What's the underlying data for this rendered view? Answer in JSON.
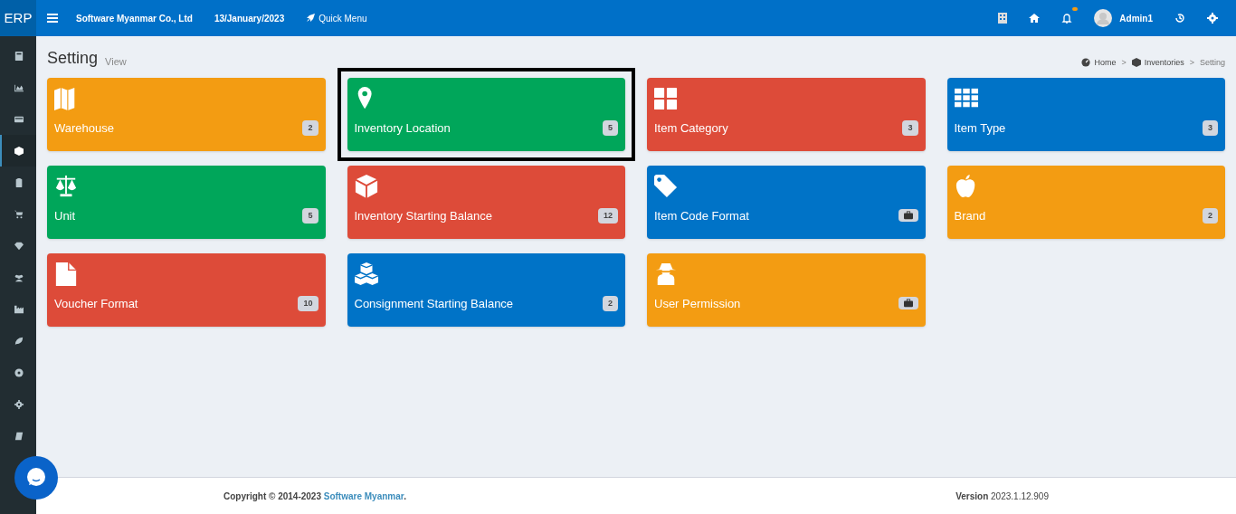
{
  "header": {
    "logo": "ERP",
    "company": "Software Myanmar Co., Ltd",
    "date": "13/January/2023",
    "quick_menu": "Quick Menu",
    "user": "Admin1",
    "notification_dot": true
  },
  "sidebar": {
    "items": [
      {
        "selected": false
      },
      {
        "selected": false
      },
      {
        "selected": false
      },
      {
        "selected": true
      },
      {
        "selected": false
      },
      {
        "selected": false
      },
      {
        "selected": false
      },
      {
        "selected": false
      },
      {
        "selected": false
      },
      {
        "selected": false
      },
      {
        "selected": false
      },
      {
        "selected": false
      },
      {
        "selected": false
      }
    ]
  },
  "page": {
    "title": "Setting",
    "subtitle": "View"
  },
  "breadcrumb": [
    {
      "kind": "link",
      "text": "Home"
    },
    {
      "kind": "separator",
      "text": ">"
    },
    {
      "kind": "link",
      "text": "Inventories"
    },
    {
      "kind": "separator",
      "text": ">"
    },
    {
      "kind": "current",
      "text": "Setting"
    }
  ],
  "tiles": [
    {
      "label": "Warehouse",
      "color": "#f39c12",
      "badge": {
        "kind": "count",
        "text": "2"
      },
      "selected": false
    },
    {
      "label": "Inventory Location",
      "color": "#00a65a",
      "badge": {
        "kind": "count",
        "text": "5"
      },
      "selected": true
    },
    {
      "label": "Item Category",
      "color": "#dd4b39",
      "badge": {
        "kind": "count",
        "text": "3"
      },
      "selected": false
    },
    {
      "label": "Item Type",
      "color": "#0073c7",
      "badge": {
        "kind": "count",
        "text": "3"
      },
      "selected": false
    },
    {
      "label": "Unit",
      "color": "#00a65a",
      "badge": {
        "kind": "count",
        "text": "5"
      },
      "selected": false
    },
    {
      "label": "Inventory Starting Balance",
      "color": "#dd4b39",
      "badge": {
        "kind": "count",
        "text": "12"
      },
      "selected": false
    },
    {
      "label": "Item Code Format",
      "color": "#0073c7",
      "badge": {
        "kind": "briefcase"
      },
      "selected": false
    },
    {
      "label": "Brand",
      "color": "#f39c12",
      "badge": {
        "kind": "count",
        "text": "2"
      },
      "selected": false
    },
    {
      "label": "Voucher Format",
      "color": "#dd4b39",
      "badge": {
        "kind": "count",
        "text": "10"
      },
      "selected": false
    },
    {
      "label": "Consignment Starting Balance",
      "color": "#0073c7",
      "badge": {
        "kind": "count",
        "text": "2"
      },
      "selected": false
    },
    {
      "label": "User Permission",
      "color": "#f39c12",
      "badge": {
        "kind": "briefcase"
      },
      "selected": false
    }
  ],
  "footer": {
    "copyright_prefix": "Copyright © 2014-2023",
    "copyright_link": "Software Myanmar",
    "copyright_suffix": ".",
    "version_label": "Version",
    "version": "2023.1.12.909"
  }
}
